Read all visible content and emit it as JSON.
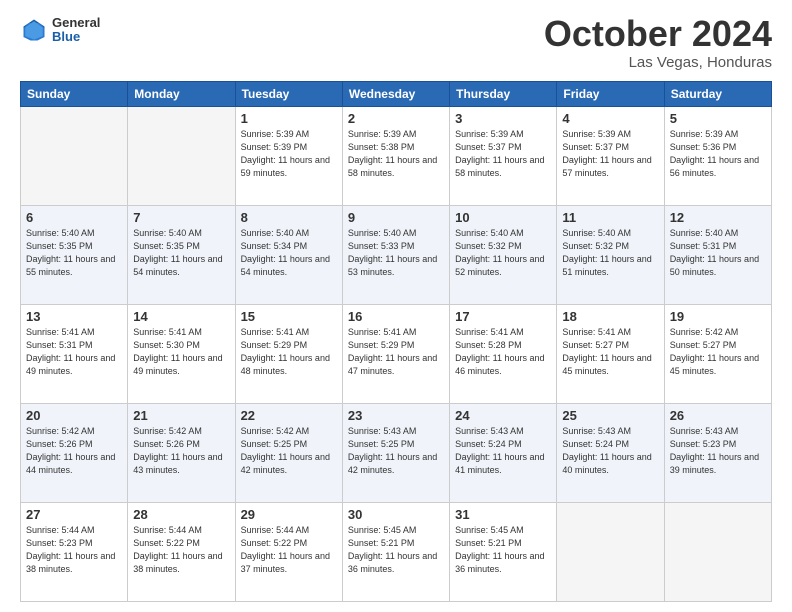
{
  "header": {
    "logo_general": "General",
    "logo_blue": "Blue",
    "month_title": "October 2024",
    "location": "Las Vegas, Honduras"
  },
  "weekdays": [
    "Sunday",
    "Monday",
    "Tuesday",
    "Wednesday",
    "Thursday",
    "Friday",
    "Saturday"
  ],
  "weeks": [
    [
      {
        "day": "",
        "empty": true
      },
      {
        "day": "",
        "empty": true
      },
      {
        "day": "1",
        "sunrise": "5:39 AM",
        "sunset": "5:39 PM",
        "daylight": "11 hours and 59 minutes."
      },
      {
        "day": "2",
        "sunrise": "5:39 AM",
        "sunset": "5:38 PM",
        "daylight": "11 hours and 58 minutes."
      },
      {
        "day": "3",
        "sunrise": "5:39 AM",
        "sunset": "5:37 PM",
        "daylight": "11 hours and 58 minutes."
      },
      {
        "day": "4",
        "sunrise": "5:39 AM",
        "sunset": "5:37 PM",
        "daylight": "11 hours and 57 minutes."
      },
      {
        "day": "5",
        "sunrise": "5:39 AM",
        "sunset": "5:36 PM",
        "daylight": "11 hours and 56 minutes."
      }
    ],
    [
      {
        "day": "6",
        "sunrise": "5:40 AM",
        "sunset": "5:35 PM",
        "daylight": "11 hours and 55 minutes."
      },
      {
        "day": "7",
        "sunrise": "5:40 AM",
        "sunset": "5:35 PM",
        "daylight": "11 hours and 54 minutes."
      },
      {
        "day": "8",
        "sunrise": "5:40 AM",
        "sunset": "5:34 PM",
        "daylight": "11 hours and 54 minutes."
      },
      {
        "day": "9",
        "sunrise": "5:40 AM",
        "sunset": "5:33 PM",
        "daylight": "11 hours and 53 minutes."
      },
      {
        "day": "10",
        "sunrise": "5:40 AM",
        "sunset": "5:32 PM",
        "daylight": "11 hours and 52 minutes."
      },
      {
        "day": "11",
        "sunrise": "5:40 AM",
        "sunset": "5:32 PM",
        "daylight": "11 hours and 51 minutes."
      },
      {
        "day": "12",
        "sunrise": "5:40 AM",
        "sunset": "5:31 PM",
        "daylight": "11 hours and 50 minutes."
      }
    ],
    [
      {
        "day": "13",
        "sunrise": "5:41 AM",
        "sunset": "5:31 PM",
        "daylight": "11 hours and 49 minutes."
      },
      {
        "day": "14",
        "sunrise": "5:41 AM",
        "sunset": "5:30 PM",
        "daylight": "11 hours and 49 minutes."
      },
      {
        "day": "15",
        "sunrise": "5:41 AM",
        "sunset": "5:29 PM",
        "daylight": "11 hours and 48 minutes."
      },
      {
        "day": "16",
        "sunrise": "5:41 AM",
        "sunset": "5:29 PM",
        "daylight": "11 hours and 47 minutes."
      },
      {
        "day": "17",
        "sunrise": "5:41 AM",
        "sunset": "5:28 PM",
        "daylight": "11 hours and 46 minutes."
      },
      {
        "day": "18",
        "sunrise": "5:41 AM",
        "sunset": "5:27 PM",
        "daylight": "11 hours and 45 minutes."
      },
      {
        "day": "19",
        "sunrise": "5:42 AM",
        "sunset": "5:27 PM",
        "daylight": "11 hours and 45 minutes."
      }
    ],
    [
      {
        "day": "20",
        "sunrise": "5:42 AM",
        "sunset": "5:26 PM",
        "daylight": "11 hours and 44 minutes."
      },
      {
        "day": "21",
        "sunrise": "5:42 AM",
        "sunset": "5:26 PM",
        "daylight": "11 hours and 43 minutes."
      },
      {
        "day": "22",
        "sunrise": "5:42 AM",
        "sunset": "5:25 PM",
        "daylight": "11 hours and 42 minutes."
      },
      {
        "day": "23",
        "sunrise": "5:43 AM",
        "sunset": "5:25 PM",
        "daylight": "11 hours and 42 minutes."
      },
      {
        "day": "24",
        "sunrise": "5:43 AM",
        "sunset": "5:24 PM",
        "daylight": "11 hours and 41 minutes."
      },
      {
        "day": "25",
        "sunrise": "5:43 AM",
        "sunset": "5:24 PM",
        "daylight": "11 hours and 40 minutes."
      },
      {
        "day": "26",
        "sunrise": "5:43 AM",
        "sunset": "5:23 PM",
        "daylight": "11 hours and 39 minutes."
      }
    ],
    [
      {
        "day": "27",
        "sunrise": "5:44 AM",
        "sunset": "5:23 PM",
        "daylight": "11 hours and 38 minutes."
      },
      {
        "day": "28",
        "sunrise": "5:44 AM",
        "sunset": "5:22 PM",
        "daylight": "11 hours and 38 minutes."
      },
      {
        "day": "29",
        "sunrise": "5:44 AM",
        "sunset": "5:22 PM",
        "daylight": "11 hours and 37 minutes."
      },
      {
        "day": "30",
        "sunrise": "5:45 AM",
        "sunset": "5:21 PM",
        "daylight": "11 hours and 36 minutes."
      },
      {
        "day": "31",
        "sunrise": "5:45 AM",
        "sunset": "5:21 PM",
        "daylight": "11 hours and 36 minutes."
      },
      {
        "day": "",
        "empty": true
      },
      {
        "day": "",
        "empty": true
      }
    ]
  ]
}
